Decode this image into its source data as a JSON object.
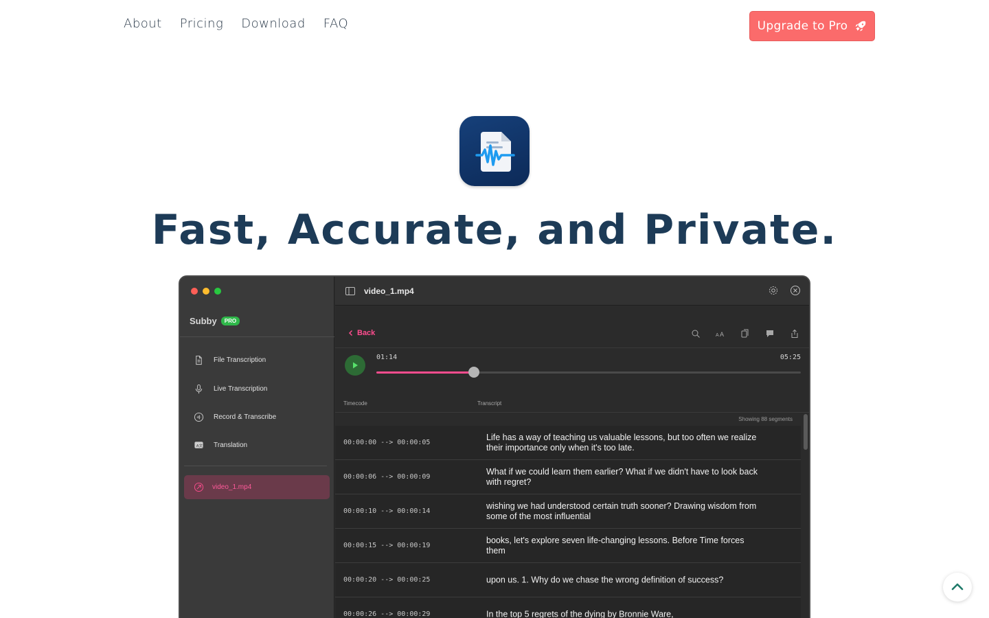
{
  "nav": {
    "links": [
      "About",
      "Pricing",
      "Download",
      "FAQ"
    ],
    "upgrade_label": "Upgrade to Pro",
    "upgrade_icon": "rocket-icon"
  },
  "hero": {
    "title": "Fast, Accurate, and Private.",
    "app_icon": "document-waveform-icon"
  },
  "app": {
    "brand": "Subby",
    "pro_badge": "PRO",
    "sidebar_items": [
      {
        "label": "File Transcription",
        "icon": "document-icon"
      },
      {
        "label": "Live Transcription",
        "icon": "microphone-icon"
      },
      {
        "label": "Record & Transcribe",
        "icon": "record-icon"
      },
      {
        "label": "Translation",
        "icon": "translate-icon"
      }
    ],
    "active_file": "video_1.mp4",
    "window_title": "video_1.mp4",
    "back_label": "Back",
    "player": {
      "current_time": "01:14",
      "total_time": "05:25",
      "progress": 0.23
    },
    "columns": {
      "timecode": "Timecode",
      "transcript": "Transcript"
    },
    "showing": "Showing 88 segments",
    "segments": [
      {
        "timecode": "00:00:00 --> 00:00:05",
        "text": "Life has a way of teaching us valuable lessons, but too often we realize their importance only when it's too late."
      },
      {
        "timecode": "00:00:06 --> 00:00:09",
        "text": "What if we could learn them earlier? What if we didn't have to look back with regret?"
      },
      {
        "timecode": "00:00:10 --> 00:00:14",
        "text": "wishing we had understood certain truth sooner? Drawing wisdom from some of the most influential"
      },
      {
        "timecode": "00:00:15 --> 00:00:19",
        "text": "books, let's explore seven life-changing lessons. Before Time forces them"
      },
      {
        "timecode": "00:00:20 --> 00:00:25",
        "text": "upon us. 1. Why do we chase the wrong definition of success?"
      },
      {
        "timecode": "00:00:26 --> 00:00:29",
        "text": "In the top 5 regrets of the dying by Bronnie Ware,"
      }
    ]
  },
  "colors": {
    "accent_coral": "#fb6b6b",
    "title_navy": "#1d3b57",
    "app_pink": "#ff4d8f",
    "pro_green": "#2fb84a"
  }
}
